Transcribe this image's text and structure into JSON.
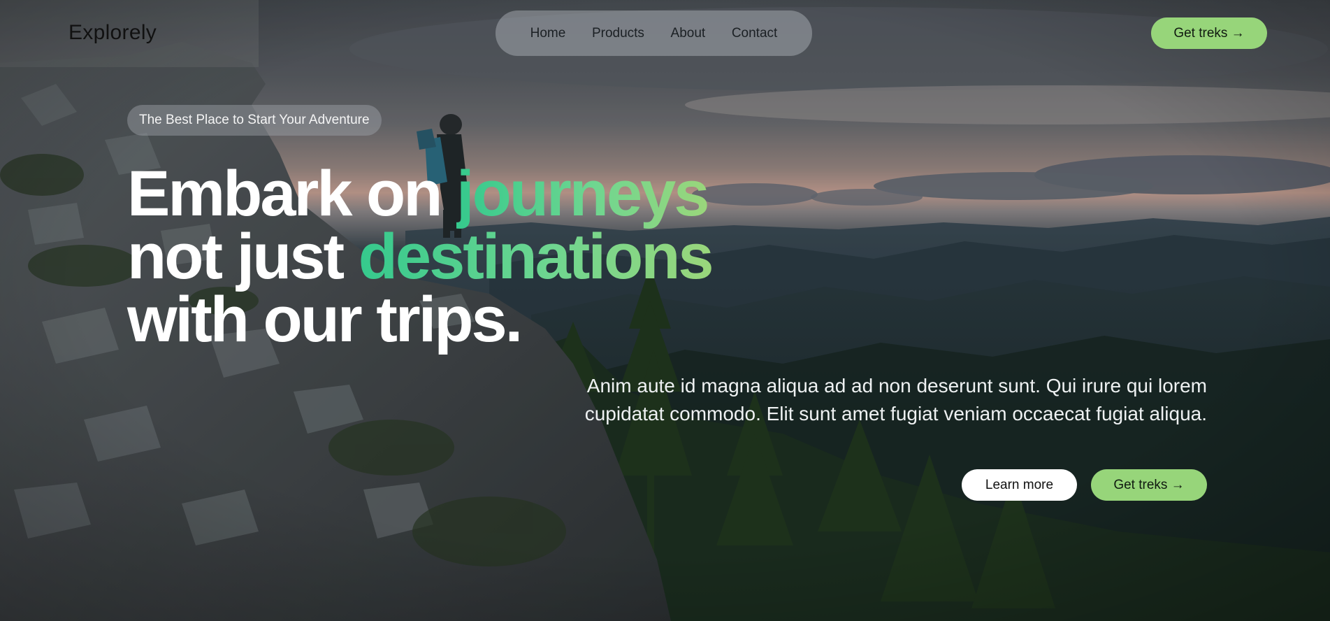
{
  "brand": {
    "name": "Explorely"
  },
  "nav": {
    "items": [
      {
        "label": "Home"
      },
      {
        "label": "Products"
      },
      {
        "label": "About"
      },
      {
        "label": "Contact"
      }
    ]
  },
  "header_cta": {
    "label": "Get treks →"
  },
  "hero": {
    "badge": "The Best Place to Start Your Adventure",
    "headline": {
      "line1_plain": "Embark on ",
      "line1_accent": "journeys",
      "line2_plain": "not just ",
      "line2_accent": "destinations",
      "line3": "with our trips."
    },
    "description": "Anim aute id magna aliqua ad ad non deserunt sunt. Qui irure qui lorem cupidatat commodo. Elit sunt amet fugiat veniam occaecat fugiat aliqua.",
    "buttons": {
      "learn_more": "Learn more",
      "get_treks": "Get treks →"
    }
  },
  "colors": {
    "accent_green": "#97d57a",
    "gradient_start": "#35c98d",
    "gradient_end": "#9ad67b",
    "headline_white": "#ffffff"
  },
  "background": {
    "image": "hiker-on-mountain-ridge-at-dusk"
  }
}
